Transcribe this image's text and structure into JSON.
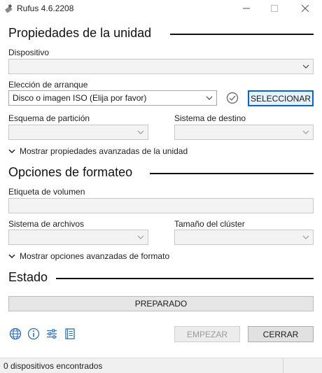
{
  "window": {
    "title": "Rufus 4.6.2208",
    "minimize_symbol": "—",
    "maximize_symbol": "☐",
    "close_symbol": "✕"
  },
  "drive_properties": {
    "heading": "Propiedades de la unidad",
    "device_label": "Dispositivo",
    "device_value": "",
    "boot_label": "Elección de arranque",
    "boot_value": "Disco o imagen ISO (Elija por favor)",
    "select_button": "SELECCIONAR",
    "partition_label": "Esquema de partición",
    "partition_value": "",
    "target_label": "Sistema de destino",
    "target_value": "",
    "advanced_toggle": "Mostrar propiedades avanzadas de la unidad"
  },
  "format_options": {
    "heading": "Opciones de formateo",
    "volume_label": "Etiqueta de volumen",
    "volume_value": "",
    "filesystem_label": "Sistema de archivos",
    "filesystem_value": "",
    "cluster_label": "Tamaño del clúster",
    "cluster_value": "",
    "advanced_toggle": "Mostrar opciones avanzadas de formato"
  },
  "status": {
    "heading": "Estado",
    "progress_text": "PREPARADO",
    "progress_fraction": 0
  },
  "actions": {
    "start_button": "EMPEZAR",
    "close_button": "CERRAR"
  },
  "toolbar_icons": [
    "globe-icon",
    "info-icon",
    "settings-sliders-icon",
    "log-icon"
  ],
  "statusbar": {
    "text": "0 dispositivos encontrados"
  },
  "colors": {
    "primary_border": "#0a64c4",
    "check_icon": "#707070"
  }
}
